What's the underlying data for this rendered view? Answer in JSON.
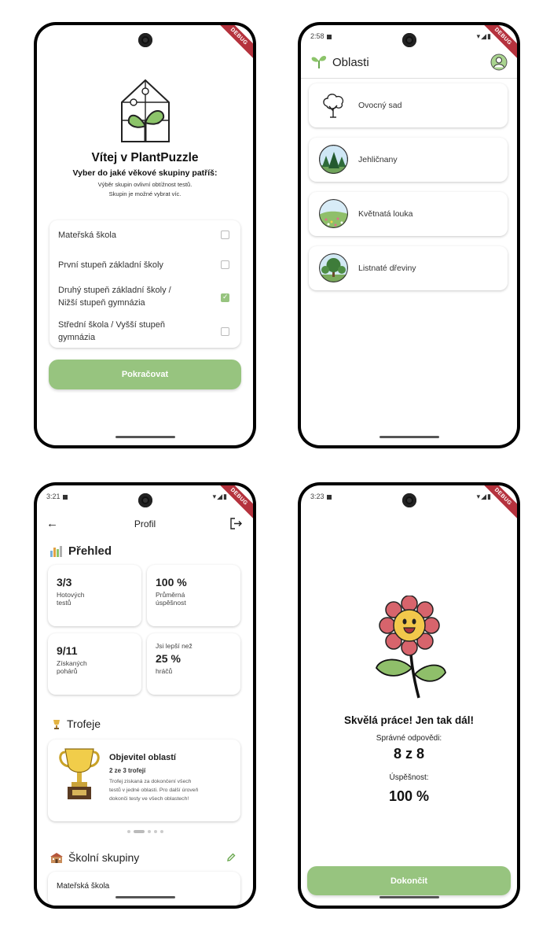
{
  "screen1": {
    "title": "Vítej v PlantPuzzle",
    "subtitle": "Vyber do jaké věkové skupiny patříš:",
    "note_line1": "Výběr skupin ovlivní obtížnost testů.",
    "note_line2": "Skupin je možné vybrat víc.",
    "options": [
      {
        "label": "Mateřská škola",
        "checked": false
      },
      {
        "label": "První stupeň základní školy",
        "checked": false
      },
      {
        "label": "Druhý stupeň základní školy /",
        "label2": "Nižší stupeň gymnázia",
        "checked": true
      },
      {
        "label": "Střední škola / Vyšší stupeň",
        "label2": "gymnázia",
        "checked": false
      }
    ],
    "continue_label": "Pokračovat",
    "debug": "DEBUG"
  },
  "screen2": {
    "time": "2:58",
    "title": "Oblasti",
    "areas": [
      {
        "label": "Ovocný sad",
        "icon": "tree-outline-icon"
      },
      {
        "label": "Jehličnany",
        "icon": "conifers-icon"
      },
      {
        "label": "Květnatá louka",
        "icon": "meadow-icon"
      },
      {
        "label": "Listnaté dřeviny",
        "icon": "deciduous-trees-icon"
      }
    ],
    "debug": "DEBUG"
  },
  "screen3": {
    "time": "3:21",
    "title": "Profil",
    "overview_title": "Přehled",
    "stats": [
      {
        "big": "3/3",
        "small1": "Hotových",
        "small2": "testů"
      },
      {
        "big": "100 %",
        "small1": "Průměrná",
        "small2": "úspěšnost"
      },
      {
        "big": "9/11",
        "small1": "Získaných",
        "small2": "pohárů"
      },
      {
        "pre": "Jsi lepší než",
        "big": "25 %",
        "small1": "hráčů"
      }
    ],
    "trophies_title": "Trofeje",
    "trophy": {
      "name": "Objevitel oblastí",
      "count": "2 ze 3 trofejí",
      "desc1": "Trofej získaná za dokončení všech",
      "desc2": "testů v jedné oblasti. Pro další úroveň",
      "desc3": "dokonči testy ve všech oblastech!"
    },
    "groups_title": "Školní skupiny",
    "group_item": "Mateřská škola",
    "debug": "DEBUG"
  },
  "screen4": {
    "time": "3:23",
    "headline": "Skvělá práce! Jen tak dál!",
    "correct_label": "Správné odpovědi:",
    "correct_value": "8 z 8",
    "success_label": "Úspěšnost:",
    "success_value": "100 %",
    "finish_label": "Dokončit",
    "debug": "DEBUG"
  },
  "colors": {
    "accent": "#97c47f",
    "debug_banner": "#b5323d"
  }
}
